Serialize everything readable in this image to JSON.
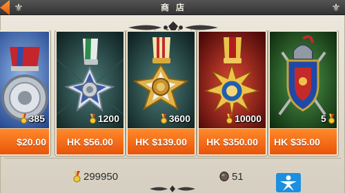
{
  "header": {
    "title": "商店",
    "back_icon": "back-arrow-icon",
    "corner_icon": "fleur-de-lis-icon"
  },
  "colors": {
    "accent": "#f26b16",
    "title_bar": "#3c3c3c",
    "panel": "#e6e0d3"
  },
  "shop": {
    "items": [
      {
        "medal_count": "385",
        "price": "$20.00",
        "art": "red-ribbon-silver-medal",
        "background": "blue"
      },
      {
        "medal_count": "1200",
        "price": "HK $56.00",
        "art": "green-ribbon-silver-star",
        "background": "dark-teal"
      },
      {
        "medal_count": "3600",
        "price": "HK $139.00",
        "art": "striped-ribbon-gold-cross",
        "background": "dark-teal"
      },
      {
        "medal_count": "10000",
        "price": "HK $350.00",
        "art": "red-ribbon-gold-sunburst",
        "background": "red"
      },
      {
        "medal_count": "5",
        "price": "HK $35.00",
        "art": "shield-helmet-crest",
        "background": "green"
      }
    ]
  },
  "footer": {
    "medals": "299950",
    "gems": "51",
    "medal_icon": "medal-currency-icon",
    "gem_icon": "gem-currency-icon"
  }
}
